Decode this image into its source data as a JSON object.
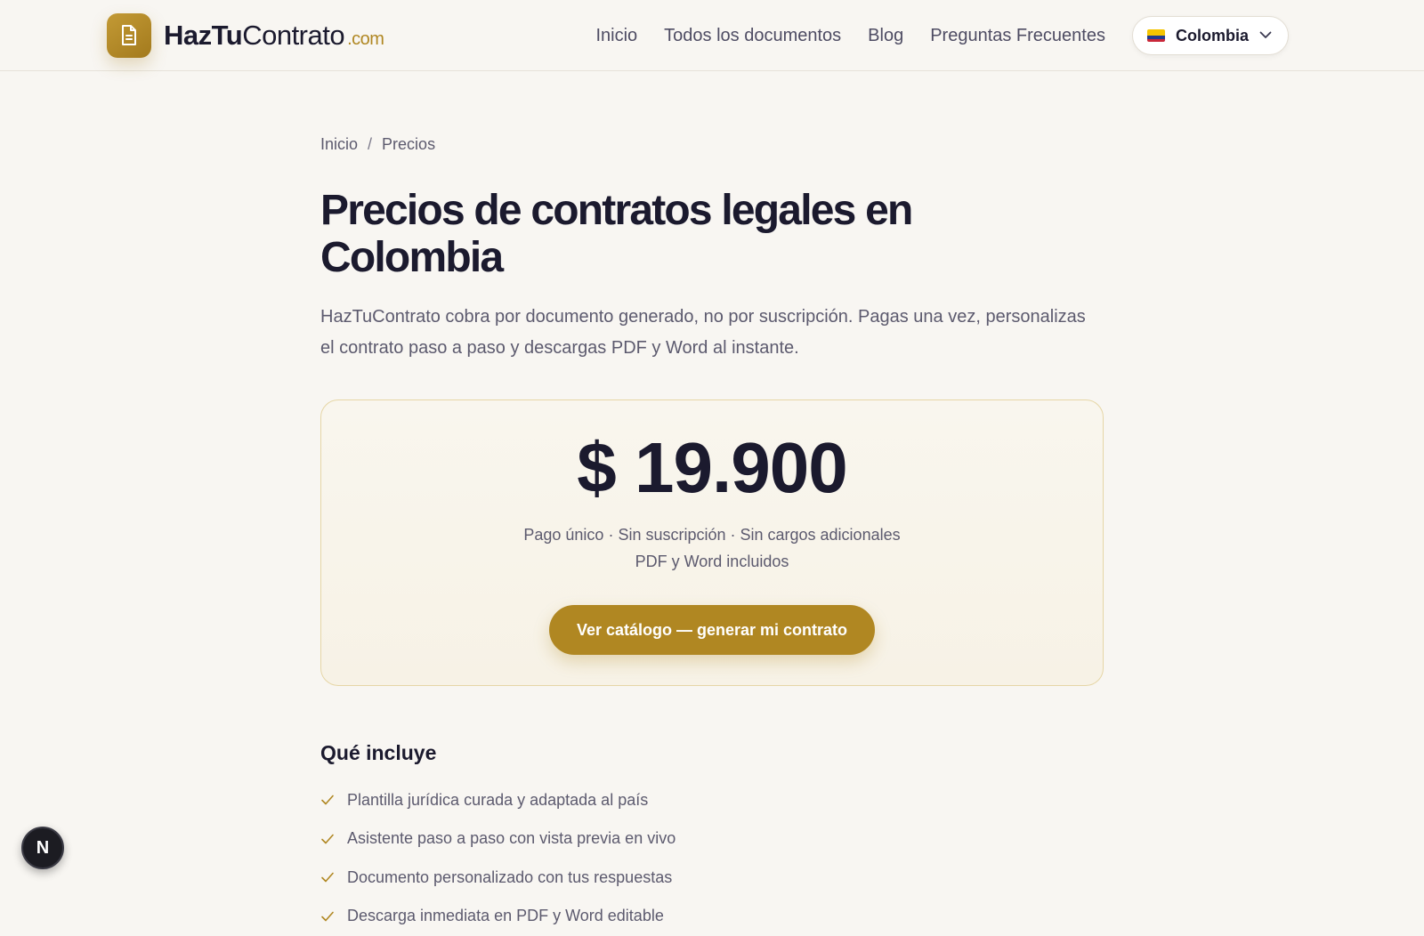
{
  "header": {
    "logo": {
      "icon": "document-icon",
      "name_bold": "HazTu",
      "name_light": "Contrato",
      "tld": ".com"
    },
    "nav": [
      {
        "label": "Inicio"
      },
      {
        "label": "Todos los documentos"
      },
      {
        "label": "Blog"
      },
      {
        "label": "Preguntas Frecuentes"
      }
    ],
    "country": {
      "label": "Colombia",
      "flag_icon": "colombia-flag-icon"
    }
  },
  "breadcrumb": {
    "items": [
      "Inicio",
      "Precios"
    ],
    "separator": "/"
  },
  "page": {
    "title": "Precios de contratos legales en Colombia",
    "lead": "HazTuContrato cobra por documento generado, no por suscripción. Pagas una vez, personalizas el contrato paso a paso y descargas PDF y Word al instante."
  },
  "pricing": {
    "price": "$ 19.900",
    "note_line1": "Pago único · Sin suscripción · Sin cargos adicionales",
    "note_line2": "PDF y Word incluidos",
    "cta_label": "Ver catálogo — generar mi contrato"
  },
  "includes": {
    "title": "Qué incluye",
    "items": [
      "Plantilla jurídica curada y adaptada al país",
      "Asistente paso a paso con vista previa en vivo",
      "Documento personalizado con tus respuestas",
      "Descarga inmediata en PDF y Word editable"
    ]
  },
  "dev_badge": {
    "label": "N"
  },
  "colors": {
    "accent": "#b08722",
    "background": "#f8f6f2",
    "text": "#1b1a2e",
    "muted": "#5c5a6e"
  }
}
